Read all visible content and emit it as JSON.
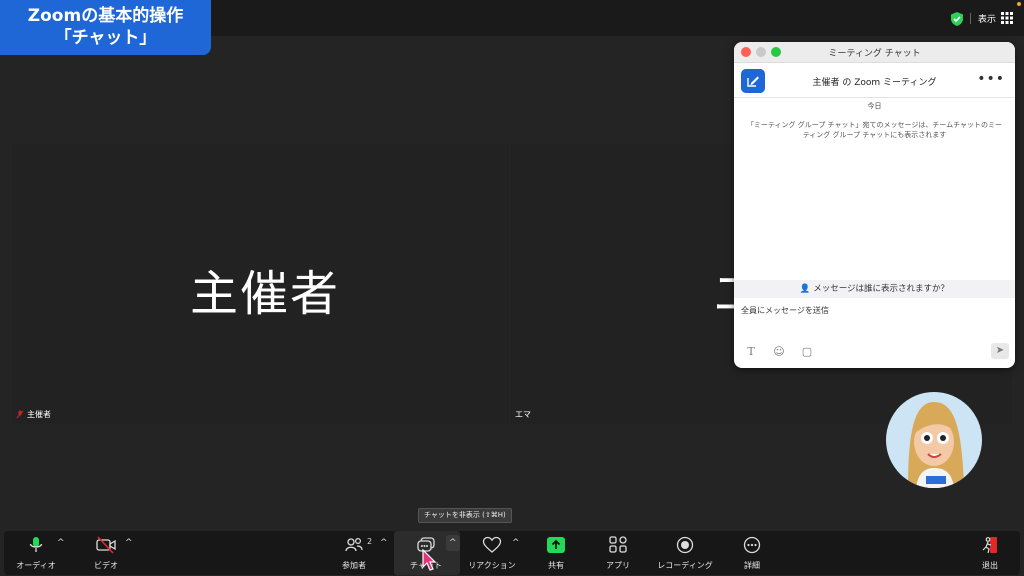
{
  "badge": {
    "line1": "Zoomの基本的操作",
    "line2": "「チャット」"
  },
  "topbar": {
    "view_label": "表示"
  },
  "tiles": {
    "host": {
      "big_name": "主催者",
      "label": "主催者"
    },
    "emma": {
      "big_name": "エ",
      "label": "エマ"
    }
  },
  "chat": {
    "window_title": "ミーティング チャット",
    "header_title": "主催者 の Zoom ミーティング",
    "more": "•••",
    "today": "今日",
    "note": "「ミーティング グループ チャット」宛てのメッセージは、チームチャットのミーティング グループ チャットにも表示されます",
    "visibility": "メッセージは誰に表示されますか？",
    "input_placeholder": "全員にメッセージを送信",
    "tools": {
      "text": "T",
      "emoji": "☺",
      "file": "▢"
    },
    "send": "➤"
  },
  "tooltip": "チャットを非表示 (⇧⌘H)",
  "toolbar": {
    "audio": "オーディオ",
    "video": "ビデオ",
    "participants": "参加者",
    "participants_count": "2",
    "chat": "チャット",
    "reactions": "リアクション",
    "share": "共有",
    "apps": "アプリ",
    "recording": "レコーディング",
    "details": "詳細",
    "leave": "退出",
    "caret": "^"
  },
  "colors": {
    "accent": "#1f67d6",
    "share_green": "#23d959",
    "leave_red": "#e02828",
    "mic_green": "#23d959"
  }
}
